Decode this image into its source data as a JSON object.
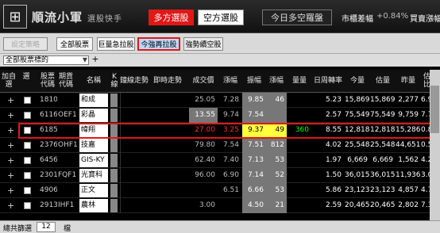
{
  "header": {
    "logo_glyph": "⊞",
    "title": "順流小軍",
    "subtitle": "選股快手",
    "bull_label": "多方選股",
    "bear_label": "空方選股",
    "today_label": "今日多空羅盤",
    "market_label": "市櫃差幅",
    "market_value": "+0.84%",
    "buy_label": "買賣漲幅",
    "buy_value": "+0.84%"
  },
  "toolbar": {
    "settings": "設定策略",
    "all": "全部股票",
    "gap": "巨量急拉股",
    "rebound": "今強再拉股",
    "short": "強勢續空股"
  },
  "filter": {
    "selected": "全部股票標的",
    "add": "+"
  },
  "columns": [
    "加自選",
    "選",
    "股票代碼",
    "期貨代碼",
    "名稱",
    "K線",
    "鐘線走勢",
    "即時走勢",
    "成交價",
    "漲幅",
    "振幅",
    "漲幅",
    "量量",
    "日周轉率",
    "今量",
    "估量",
    "昨量",
    "估量比例"
  ],
  "rows": [
    {
      "code": "1810",
      "fut": "",
      "name": "和成",
      "price": "25.05",
      "chg": "7.28",
      "amp": "9.85",
      "up": "46",
      "vol": "",
      "turn": "5.23",
      "today": "15,869",
      "est": "15,869",
      "yest": "2,277",
      "ratio": "6.97"
    },
    {
      "code": "6116",
      "fut": "OEF1",
      "name": "彩晶",
      "price": "13.55",
      "chg": "9.74",
      "amp": "7.54",
      "up": "",
      "vol": "",
      "turn": "2.57",
      "today": "75,549",
      "est": "75,549",
      "yest": "9,759",
      "ratio": "7.74"
    },
    {
      "code": "6185",
      "fut": "",
      "name": "幃翔",
      "price": "27.00",
      "chg": "3.25",
      "amp": "9.37",
      "up": "49",
      "vol": "360",
      "turn": "8.55",
      "today": "12,818",
      "est": "12,818",
      "yest": "15,286",
      "ratio": "0.84"
    },
    {
      "code": "2376",
      "fut": "OHF1",
      "name": "技嘉",
      "price": "79.80",
      "chg": "7.54",
      "amp": "7.51",
      "up": "812",
      "vol": "",
      "turn": "4.02",
      "today": "25,548",
      "est": "25,548",
      "yest": "44,651",
      "ratio": "0.57"
    },
    {
      "code": "6456",
      "fut": "",
      "name": "GIS-KY",
      "price": "62.40",
      "chg": "7.40",
      "amp": "7.13",
      "up": "53",
      "vol": "",
      "turn": "1.97",
      "today": "6,669",
      "est": "6,669",
      "yest": "1,562",
      "ratio": "4.27"
    },
    {
      "code": "2301",
      "fut": "FQF1",
      "name": "光寶科",
      "price": "96.00",
      "chg": "6.90",
      "amp": "7.14",
      "up": "52",
      "vol": "",
      "turn": "1.50",
      "today": "36,015",
      "est": "36,015",
      "yest": "11,936",
      "ratio": "3.02"
    },
    {
      "code": "4906",
      "fut": "",
      "name": "正文",
      "price": "",
      "chg": "6.51",
      "amp": "6.66",
      "up": "53",
      "vol": "",
      "turn": "5.86",
      "today": "23,123",
      "est": "23,123",
      "yest": "4,857",
      "ratio": "4.76"
    },
    {
      "code": "2913",
      "fut": "IHF1",
      "name": "農林",
      "price": "3.00",
      "chg": "",
      "amp": "4.50",
      "up": "21",
      "vol": "",
      "turn": "2.59",
      "today": "20,465",
      "est": "20,465",
      "yest": "2,802",
      "ratio": "7.30"
    }
  ],
  "status": {
    "label": "總共篩選",
    "count": "12",
    "unit": "檔"
  },
  "colors": {
    "accent": "#e01818",
    "up": "#ff3030",
    "yellow": "#ffff40",
    "green": "#00e000"
  }
}
